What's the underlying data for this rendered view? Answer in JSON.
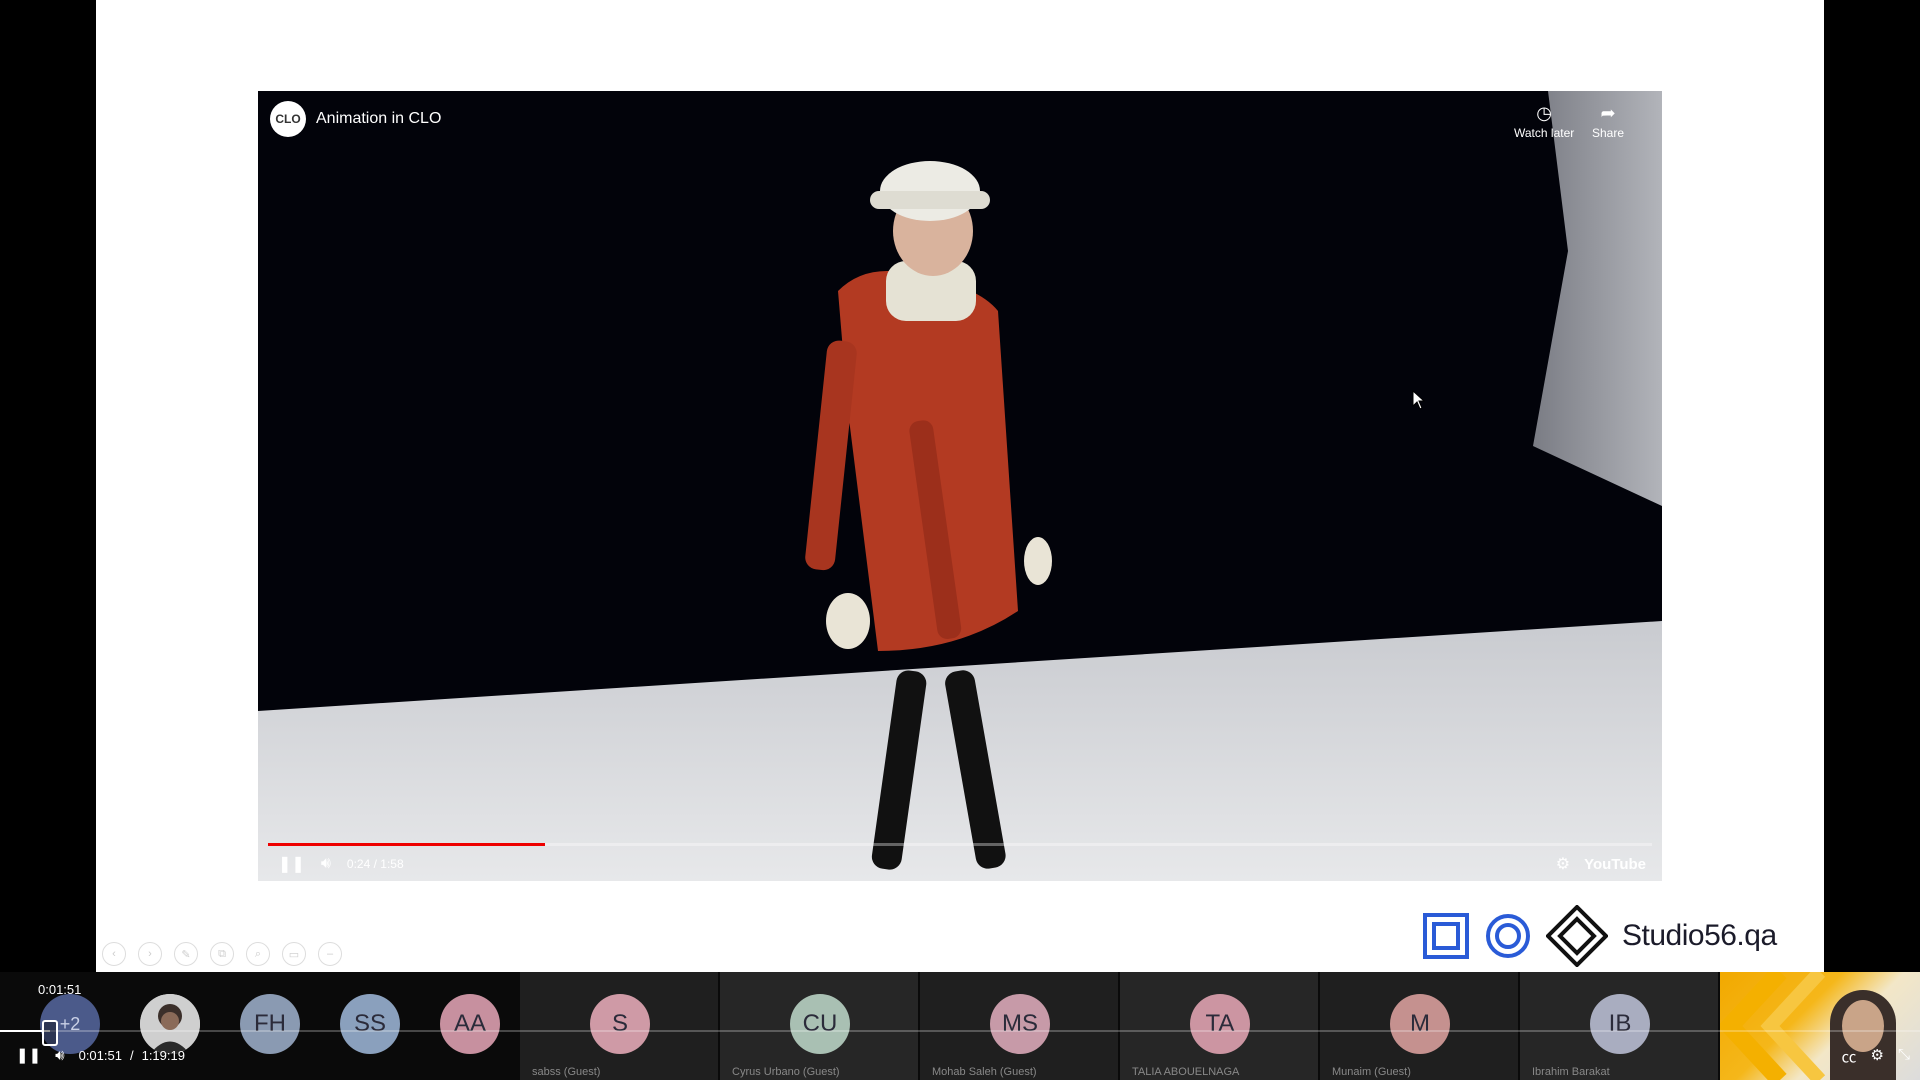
{
  "youtube": {
    "channel_logo": "CLO",
    "title": "Animation in CLO",
    "watch_later_label": "Watch later",
    "share_label": "Share",
    "time": "0:24 / 1:58",
    "progress": 0.2,
    "brand": "YouTube",
    "icons": [
      "clock-icon",
      "share-arrow-icon",
      "pause-icon",
      "volume-icon",
      "gear-icon"
    ]
  },
  "slide": {
    "logo_text": "Studio56.qa",
    "tool_icons": [
      "‹",
      "›",
      "✎",
      "⧉",
      "⌕",
      "▭",
      "–"
    ]
  },
  "participants": {
    "overflow": "+2",
    "avatars": [
      {
        "initials": "FH",
        "color": "#8a9ab2"
      },
      {
        "initials": "SS",
        "color": "#8aa0bd"
      },
      {
        "initials": "AA",
        "color": "#c7909f"
      }
    ],
    "tiles": [
      {
        "initials": "S",
        "name": "sabss (Guest)",
        "color": "#cf9aa6"
      },
      {
        "initials": "CU",
        "name": "Cyrus Urbano (Guest)",
        "color": "#a9c0b3"
      },
      {
        "initials": "MS",
        "name": "Mohab Saleh (Guest)",
        "color": "#c79aa8"
      },
      {
        "initials": "TA",
        "name": "TALIA ABOUELNAGA",
        "color": "#cc95a2"
      },
      {
        "initials": "M",
        "name": "Munaim (Guest)",
        "color": "#c5918f"
      },
      {
        "initials": "IB",
        "name": "Ibrahim Barakat",
        "color": "#a9adc0"
      }
    ]
  },
  "player": {
    "hover_time": "0:01:51",
    "current_time": "0:01:51",
    "separator": "/",
    "duration": "1:19:19",
    "progress": 0.026
  },
  "colors": {
    "accent": "#e00000",
    "strip": "#0a0a0a"
  }
}
